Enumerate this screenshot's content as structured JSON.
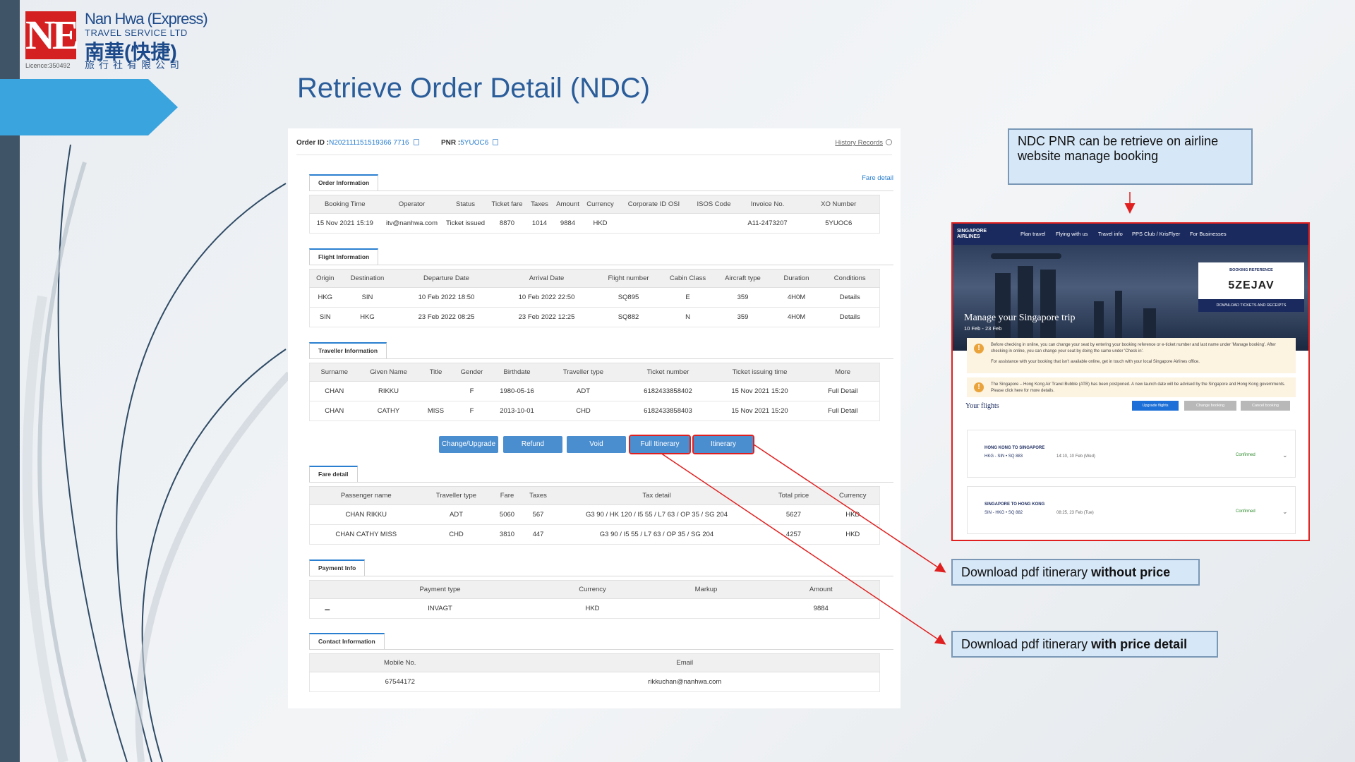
{
  "logo": {
    "en": "Nan Hwa (Express)",
    "en2": "TRAVEL SERVICE LTD",
    "cn": "南華(快捷)",
    "cn2": "旅行社有限公司",
    "mark": "NE",
    "licence": "Licence:350492"
  },
  "title": "Retrieve Order Detail (NDC)",
  "order": {
    "id_label": "Order ID :",
    "id": "N202111151519366 7716",
    "pnr_label": "PNR :",
    "pnr": "5YUOC6",
    "history": "History Records"
  },
  "fare_detail_link": "Fare detail",
  "sections": {
    "order_info": "Order Information",
    "flight_info": "Flight Information",
    "traveller_info": "Traveller Information",
    "fare_detail": "Fare detail",
    "payment_info": "Payment Info",
    "contact_info": "Contact Information"
  },
  "order_table": {
    "headers": [
      "Booking Time",
      "Operator",
      "Status",
      "Ticket fare",
      "Taxes",
      "Amount",
      "Currency",
      "Corporate ID OSI",
      "ISOS Code",
      "Invoice No.",
      "XO Number"
    ],
    "row": [
      "15 Nov 2021 15:19",
      "itv@nanhwa.com",
      "Ticket issued",
      "8870",
      "1014",
      "9884",
      "HKD",
      "",
      "",
      "A11-2473207",
      "5YUOC6"
    ]
  },
  "flight_table": {
    "headers": [
      "Origin",
      "Destination",
      "Departure Date",
      "Arrival Date",
      "Flight number",
      "Cabin Class",
      "Aircraft type",
      "Duration",
      "Conditions"
    ],
    "rows": [
      [
        "HKG",
        "SIN",
        "10 Feb 2022 18:50",
        "10 Feb 2022 22:50",
        "SQ895",
        "E",
        "359",
        "4H0M",
        "Details"
      ],
      [
        "SIN",
        "HKG",
        "23 Feb 2022 08:25",
        "23 Feb 2022 12:25",
        "SQ882",
        "N",
        "359",
        "4H0M",
        "Details"
      ]
    ]
  },
  "traveller_table": {
    "headers": [
      "Surname",
      "Given Name",
      "Title",
      "Gender",
      "Birthdate",
      "Traveller type",
      "Ticket number",
      "Ticket issuing time",
      "More"
    ],
    "rows": [
      [
        "CHAN",
        "RIKKU",
        "",
        "F",
        "1980-05-16",
        "ADT",
        "6182433858402",
        "15 Nov 2021 15:20",
        "Full Detail"
      ],
      [
        "CHAN",
        "CATHY",
        "MISS",
        "F",
        "2013-10-01",
        "CHD",
        "6182433858403",
        "15 Nov 2021 15:20",
        "Full Detail"
      ]
    ]
  },
  "buttons": [
    "Change/Upgrade",
    "Refund",
    "Void",
    "Full Itinerary",
    "Itinerary"
  ],
  "fare_table": {
    "headers": [
      "Passenger name",
      "Traveller type",
      "Fare",
      "Taxes",
      "Tax detail",
      "Total price",
      "Currency"
    ],
    "rows": [
      [
        "CHAN RIKKU",
        "ADT",
        "5060",
        "567",
        "G3 90 / HK 120 / I5 55 / L7 63 / OP 35 / SG 204",
        "5627",
        "HKD"
      ],
      [
        "CHAN CATHY MISS",
        "CHD",
        "3810",
        "447",
        "G3 90 / I5 55 / L7 63 / OP 35 / SG 204",
        "4257",
        "HKD"
      ]
    ]
  },
  "payment_table": {
    "headers": [
      "",
      "Payment type",
      "Currency",
      "Markup",
      "Amount"
    ],
    "row": [
      "–",
      "INVAGT",
      "HKD",
      "",
      "9884"
    ]
  },
  "contact_table": {
    "headers": [
      "Mobile No.",
      "Email"
    ],
    "row": [
      "67544172",
      "rikkuchan@nanhwa.com"
    ]
  },
  "callouts": {
    "ndc_pnr": "NDC PNR can be retrieve on airline website manage booking",
    "without_price_a": "Download pdf itinerary ",
    "without_price_b": "without price",
    "with_price_a": "Download pdf itinerary ",
    "with_price_b": "with price detail"
  },
  "sia": {
    "logo": "SINGAPORE AIRLINES",
    "nav": [
      "Plan travel",
      "Flying with us",
      "Travel info",
      "PPS Club / KrisFlyer",
      "For Businesses"
    ],
    "manage": "Manage your Singapore trip",
    "dates": "10 Feb - 23 Feb",
    "ref_label": "BOOKING REFERENCE",
    "ref_code": "5ZEJAV",
    "download": "DOWNLOAD TICKETS AND RECEIPTS",
    "notice1": "Before checking in online, you can change your seat by entering your booking reference or e-ticket number and last name under 'Manage booking'. After checking in online, you can change your seat by doing the same under 'Check in'.",
    "notice1b": "For assistance with your booking that isn't available online, get in touch with your local Singapore Airlines office.",
    "notice2": "The Singapore – Hong Kong Air Travel Bubble (ATB) has been postponed. A new launch date will be advised by the Singapore and Hong Kong governments. Please click here for more details.",
    "your_flights": "Your flights",
    "btn_upgrade": "Upgrade flights",
    "btn_change": "Change booking",
    "btn_cancel": "Cancel booking",
    "flights": [
      {
        "title": "HONG KONG TO SINGAPORE",
        "route": "HKG - SIN  •  SQ 883",
        "time": "14:10, 10 Feb (Wed)",
        "status": "Confirmed"
      },
      {
        "title": "SINGAPORE TO HONG KONG",
        "route": "SIN - HKG  •  SQ 882",
        "time": "08:25, 23 Feb (Tue)",
        "status": "Confirmed"
      }
    ]
  },
  "colors": {
    "accent": "#2a7fd0",
    "button": "#4a8ed0",
    "highlight": "#e02020",
    "title": "#2a5d9a",
    "sia_navy": "#1a2a5e"
  }
}
